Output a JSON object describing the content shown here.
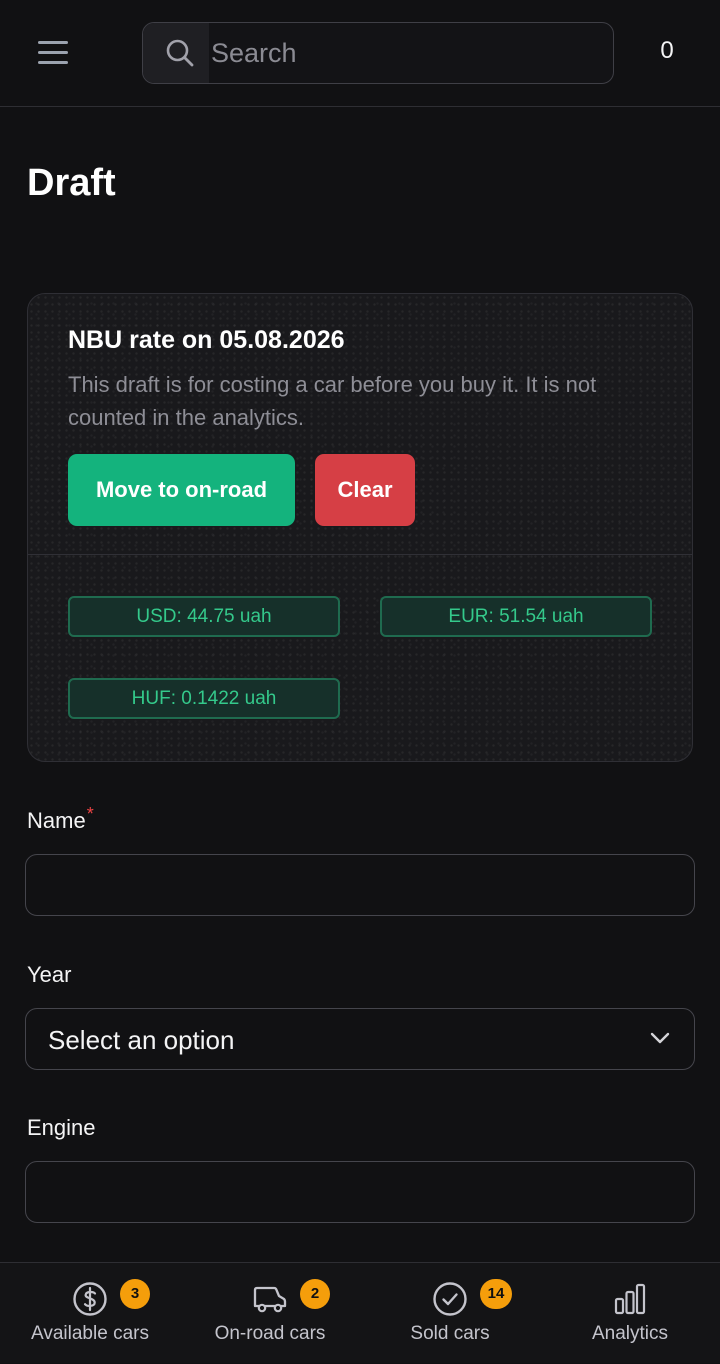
{
  "header": {
    "menu_icon": "hamburger-menu-icon",
    "search_icon": "search-icon",
    "search_placeholder": "Search",
    "count": "0"
  },
  "page": {
    "title": "Draft"
  },
  "rate_card": {
    "title": "NBU rate on 05.08.2026",
    "description": "This draft is for costing a car before you buy it. It is not counted in the analytics.",
    "move_button": "Move to on-road",
    "clear_button": "Clear",
    "rates": {
      "usd": "USD: 44.75 uah",
      "eur": "EUR: 51.54 uah",
      "huf": "HUF: 0.1422 uah"
    },
    "colors": {
      "move_button": "#14b37d",
      "clear_button": "#d63f45",
      "rate_chip_text": "#34c98b"
    }
  },
  "form": {
    "name_label": "Name",
    "name_required_mark": "*",
    "name_value": "",
    "year_label": "Year",
    "year_selected": "Select an option",
    "engine_label": "Engine",
    "engine_value": ""
  },
  "bottom_nav": {
    "items": [
      {
        "label": "Available cars",
        "icon": "dollar-circle-icon",
        "badge": "3"
      },
      {
        "label": "On-road cars",
        "icon": "truck-icon",
        "badge": "2"
      },
      {
        "label": "Sold cars",
        "icon": "check-circle-icon",
        "badge": "14"
      },
      {
        "label": "Analytics",
        "icon": "bar-chart-icon",
        "badge": ""
      }
    ],
    "badge_color": "#f59e0b"
  }
}
